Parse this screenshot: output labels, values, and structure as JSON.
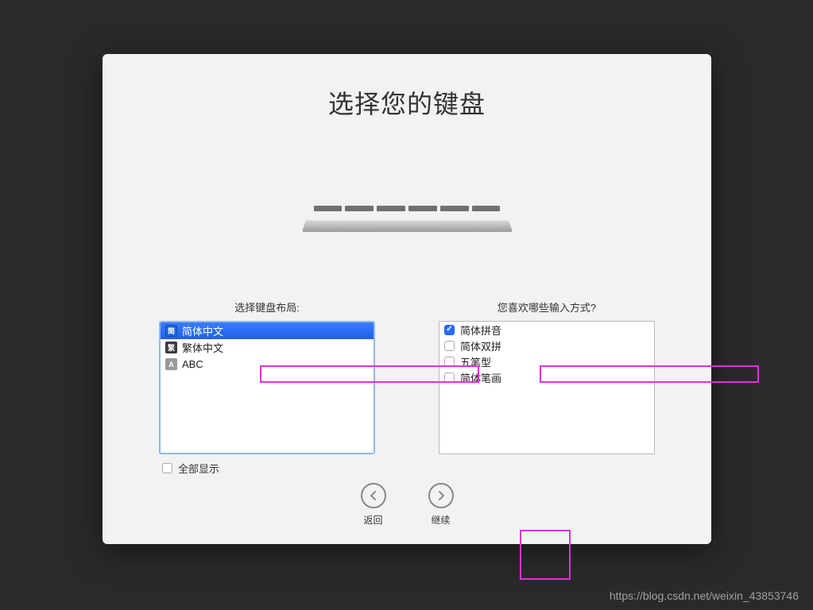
{
  "title": "选择您的键盘",
  "left_column": {
    "label": "选择键盘布局:",
    "items": [
      {
        "icon_char": "简",
        "icon_class": "ic-blue",
        "label": "简体中文",
        "selected": true
      },
      {
        "icon_char": "繁",
        "icon_class": "ic-dark",
        "label": "繁体中文",
        "selected": false
      },
      {
        "icon_char": "A",
        "icon_class": "ic-gray",
        "label": "ABC",
        "selected": false
      }
    ],
    "show_all_label": "全部显示"
  },
  "right_column": {
    "label": "您喜欢哪些输入方式?",
    "items": [
      {
        "label": "简体拼音",
        "checked": true
      },
      {
        "label": "简体双拼",
        "checked": false
      },
      {
        "label": "五笔型",
        "checked": false
      },
      {
        "label": "简体笔画",
        "checked": false
      }
    ]
  },
  "nav": {
    "back": "返回",
    "continue": "继续"
  },
  "watermark": "https://blog.csdn.net/weixin_43853746"
}
